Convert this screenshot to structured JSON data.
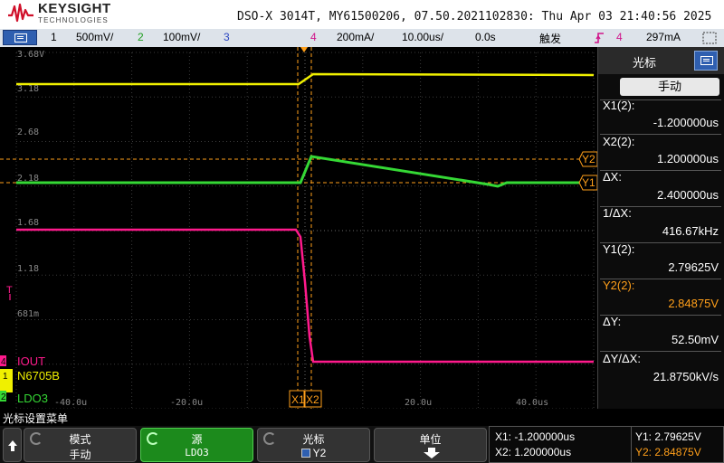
{
  "header": {
    "brand": "KEYSIGHT",
    "brand_sub": "TECHNOLOGIES",
    "model_line": "DSO-X 3014T, MY61500206, 07.50.2021102830: Thu Apr 03 21:40:56 2025"
  },
  "channel_bar": {
    "ch1_num": "1",
    "ch1_scale": "500mV/",
    "ch2_num": "2",
    "ch2_scale": "100mV/",
    "ch3_num": "3",
    "ch4_num": "4",
    "ch4_scale": "200mA/",
    "timebase": "10.00us/",
    "delay": "0.0s",
    "trigger_label": "触发",
    "trig_ch": "4",
    "trig_level": "297mA"
  },
  "graticule": {
    "y_labels": [
      "3.68V",
      "3.18",
      "2.68",
      "2.18",
      "1.68",
      "1.18",
      "681m"
    ],
    "x_labels": [
      "-40.0u",
      "-20.0u",
      "20.0u",
      "40.0us"
    ],
    "cursor_x1": "X1",
    "cursor_x2": "X2",
    "cursor_y1": "Y1",
    "cursor_y2": "Y2",
    "trig_marker": "T",
    "ch4_label": "IOUT",
    "ch1_label": "N6705B",
    "ch2_label": "LDO3",
    "ch4_marker": "4",
    "ch1_marker": "1",
    "ch2_marker": "2"
  },
  "right_panel": {
    "title": "光标",
    "mode": "手动",
    "x1_label": "X1(2):",
    "x1_value": "-1.200000us",
    "x2_label": "X2(2):",
    "x2_value": "1.200000us",
    "dx_label": "ΔX:",
    "dx_value": "2.400000us",
    "inv_dx_label": "1/ΔX:",
    "inv_dx_value": "416.67kHz",
    "y1_label": "Y1(2):",
    "y1_value": "2.79625V",
    "y2_label": "Y2(2):",
    "y2_value": "2.84875V",
    "dy_label": "ΔY:",
    "dy_value": "52.50mV",
    "dydx_label": "ΔY/ΔX:",
    "dydx_value": "21.8750kV/s"
  },
  "status_line": "光标设置菜单",
  "softkeys": {
    "mode_title": "模式",
    "mode_value": "手动",
    "source_title": "源",
    "source_value": "LDO3",
    "cursor_title": "光标",
    "cursor_value": "Y2",
    "units_title": "单位"
  },
  "readout": {
    "x1": "X1:  -1.200000us",
    "x2": "X2:  1.200000us",
    "y1": "Y1: 2.79625V",
    "y2": "Y2: 2.84875V"
  },
  "colors": {
    "ch1": "#f0f000",
    "ch2": "#35d835",
    "ch4": "#ff1a8c",
    "cursor": "#ff9f1a",
    "grid": "#5a5a5a"
  }
}
